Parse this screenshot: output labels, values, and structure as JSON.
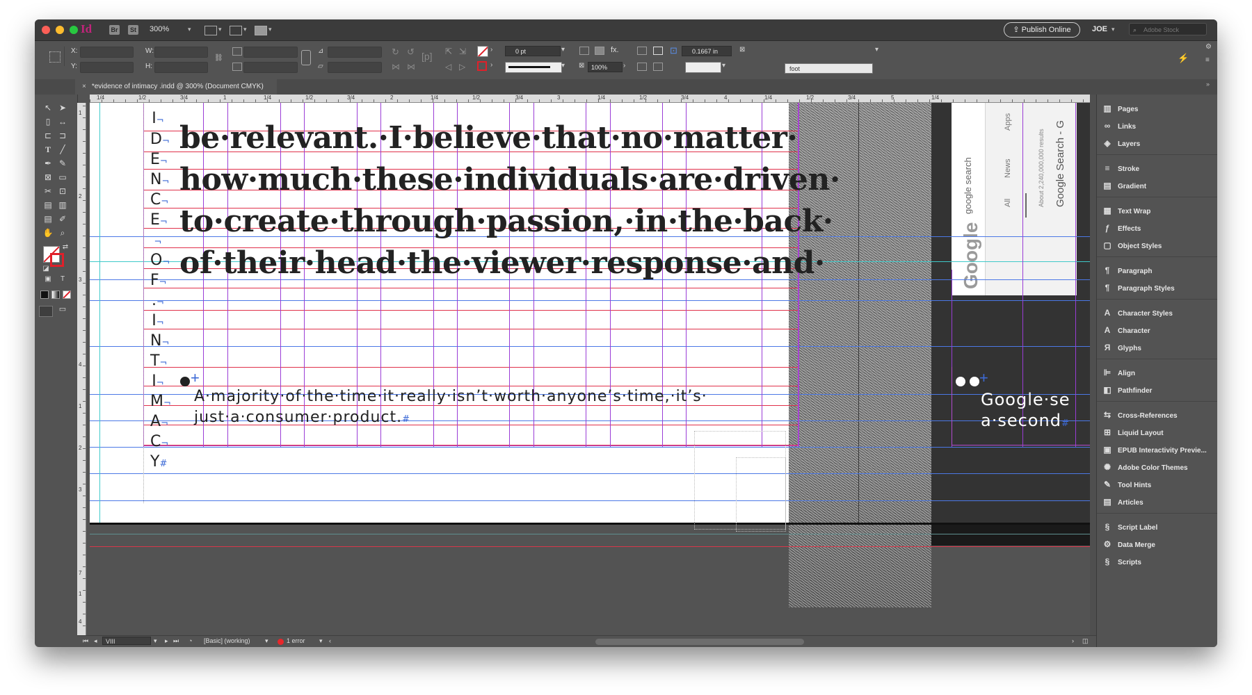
{
  "app": {
    "logo": "Id",
    "bridge_label": "Br",
    "stock_label": "St",
    "zoom": "300%",
    "publish_label": "Publish Online",
    "user": "JOE",
    "search_placeholder": "Adobe Stock"
  },
  "control_bar": {
    "x_label": "X:",
    "y_label": "Y:",
    "w_label": "W:",
    "h_label": "H:",
    "stroke_weight": "0 pt",
    "opacity": "100%",
    "size": "0.1667 in",
    "object_style": "foot",
    "fx_label": "fx."
  },
  "document": {
    "tab_title": "*evidence of intimacy .indd @ 300% (Document CMYK)",
    "close": "×",
    "vertical_letters": [
      "I",
      "D",
      "E",
      "N",
      "C",
      "E",
      "",
      "O",
      "F",
      ".",
      "I",
      "N",
      "T",
      "I",
      "M",
      "A",
      "C",
      "Y"
    ],
    "end_mark": "#",
    "body_lines": [
      "be·relevant.·I·believe·that·no·matter·",
      "how·much·these·individuals·are·driven·",
      "to·create·through·passion,·in·the·back·",
      "of·their·head·the·viewer·response·and·"
    ],
    "caption_lines": [
      "A·majority·of·the·time·it·really·isn’t·worth·anyone’s·time,·it’s·",
      "just·a·consumer·product."
    ],
    "right_caption_lines": [
      "Google·se",
      "a·second"
    ],
    "google_shot": {
      "logo": "Google",
      "search_text": "google search",
      "tab_all": "All",
      "tab_news": "News",
      "tab_apps": "Apps",
      "results": "About 2,240,000,000 results",
      "title": "Google Search - G"
    }
  },
  "ruler": {
    "top_labels": [
      "1/4",
      "1/2",
      "3/4",
      "1",
      "1/4",
      "1/2",
      "3/4",
      "2",
      "1/4",
      "1/2",
      "3/4",
      "3",
      "1/4",
      "1/2",
      "3/4",
      "4",
      "1/4",
      "1/2",
      "3/4",
      "5",
      "1/4"
    ],
    "left_labels": [
      "1",
      "2",
      "3",
      "4",
      "1",
      "2",
      "3",
      "7",
      "1",
      "4"
    ]
  },
  "panels": [
    {
      "icon": "pages-icon",
      "glyph": "▥",
      "label": "Pages"
    },
    {
      "icon": "links-icon",
      "glyph": "∞",
      "label": "Links"
    },
    {
      "icon": "layers-icon",
      "glyph": "◈",
      "label": "Layers"
    },
    {
      "icon": "stroke-icon",
      "glyph": "≡",
      "label": "Stroke"
    },
    {
      "icon": "gradient-icon",
      "glyph": "▤",
      "label": "Gradient"
    },
    {
      "icon": "text-wrap-icon",
      "glyph": "▦",
      "label": "Text Wrap"
    },
    {
      "icon": "effects-icon",
      "glyph": "ƒ",
      "label": "Effects"
    },
    {
      "icon": "object-styles-icon",
      "glyph": "▢",
      "label": "Object Styles"
    },
    {
      "icon": "paragraph-icon",
      "glyph": "¶",
      "label": "Paragraph"
    },
    {
      "icon": "paragraph-styles-icon",
      "glyph": "¶",
      "label": "Paragraph Styles"
    },
    {
      "icon": "character-styles-icon",
      "glyph": "A",
      "label": "Character Styles"
    },
    {
      "icon": "character-icon",
      "glyph": "A",
      "label": "Character"
    },
    {
      "icon": "glyphs-icon",
      "glyph": "Я",
      "label": "Glyphs"
    },
    {
      "icon": "align-icon",
      "glyph": "⊫",
      "label": "Align"
    },
    {
      "icon": "pathfinder-icon",
      "glyph": "◧",
      "label": "Pathfinder"
    },
    {
      "icon": "cross-references-icon",
      "glyph": "⇆",
      "label": "Cross-References"
    },
    {
      "icon": "liquid-layout-icon",
      "glyph": "⊞",
      "label": "Liquid Layout"
    },
    {
      "icon": "epub-icon",
      "glyph": "▣",
      "label": "EPUB Interactivity Previe..."
    },
    {
      "icon": "color-themes-icon",
      "glyph": "✺",
      "label": "Adobe Color Themes"
    },
    {
      "icon": "tool-hints-icon",
      "glyph": "✎",
      "label": "Tool Hints"
    },
    {
      "icon": "articles-icon",
      "glyph": "▤",
      "label": "Articles"
    },
    {
      "icon": "script-label-icon",
      "glyph": "§",
      "label": "Script Label"
    },
    {
      "icon": "data-merge-icon",
      "glyph": "⚙",
      "label": "Data Merge"
    },
    {
      "icon": "scripts-icon",
      "glyph": "§",
      "label": "Scripts"
    }
  ],
  "status_bar": {
    "page": "VIII",
    "style": "[Basic] (working)",
    "errors": "1 error"
  },
  "colors": {
    "accent_magenta": "#c0247a",
    "baseline_red": "#e0304a",
    "guide_blue": "#4b78e6",
    "column_purple": "#9a3cd6",
    "error_red": "#e8262a"
  }
}
